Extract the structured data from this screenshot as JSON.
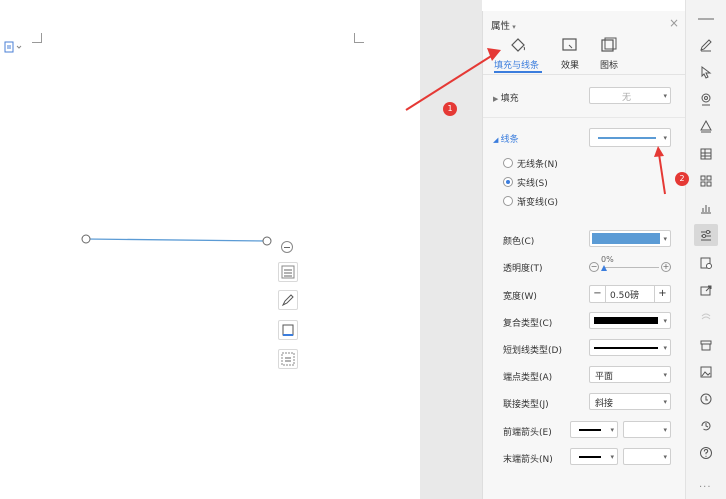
{
  "panel": {
    "title": "属性",
    "tabs": [
      {
        "label": "填充与线条",
        "active": true,
        "icon": "fill-bucket-icon"
      },
      {
        "label": "效果",
        "active": false,
        "icon": "effects-icon"
      },
      {
        "label": "图标",
        "active": false,
        "icon": "icon-tab-icon"
      }
    ],
    "fill": {
      "label": "填充",
      "value": "无"
    },
    "line": {
      "label": "线条"
    },
    "line_options": [
      {
        "label": "无线条(N)",
        "selected": false
      },
      {
        "label": "实线(S)",
        "selected": true
      },
      {
        "label": "渐变线(G)",
        "selected": false
      }
    ],
    "props": {
      "color_label": "颜色(C)",
      "color_value": "#5b9bd5",
      "transparency_label": "透明度(T)",
      "transparency_value": "0%",
      "width_label": "宽度(W)",
      "width_value": "0.50磅",
      "width_minus": "−",
      "width_plus": "+",
      "compound_label": "复合类型(C)",
      "dash_label": "短划线类型(D)",
      "cap_label": "端点类型(A)",
      "cap_value": "平面",
      "join_label": "联接类型(J)",
      "join_value": "斜接",
      "begin_arrow_label": "前端箭头(E)",
      "end_arrow_label": "末端箭头(N)"
    }
  },
  "annotations": {
    "one": "1",
    "two": "2"
  },
  "colors": {
    "accent": "#3b7ddd",
    "line_blue": "#5b9bd5",
    "arrow_red": "#e53935"
  }
}
